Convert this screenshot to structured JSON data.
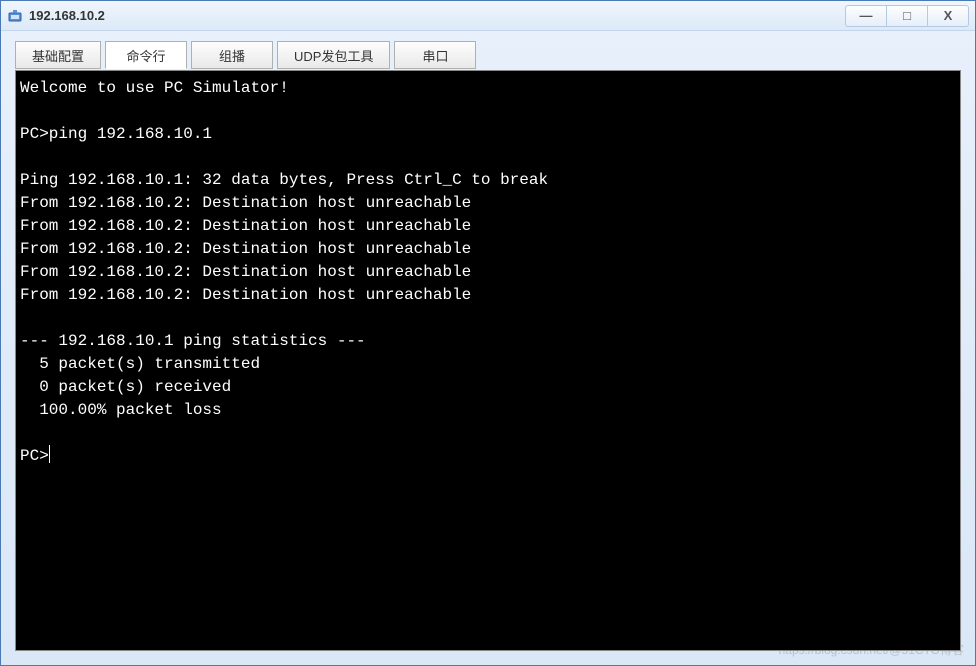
{
  "window": {
    "title": "192.168.10.2"
  },
  "controls": {
    "minimize": "—",
    "maximize": "□",
    "close": "X"
  },
  "tabs": [
    {
      "label": "基础配置",
      "active": false
    },
    {
      "label": "命令行",
      "active": true
    },
    {
      "label": "组播",
      "active": false
    },
    {
      "label": "UDP发包工具",
      "active": false
    },
    {
      "label": "串口",
      "active": false
    }
  ],
  "terminal": {
    "lines": [
      "Welcome to use PC Simulator!",
      "",
      "PC>ping 192.168.10.1",
      "",
      "Ping 192.168.10.1: 32 data bytes, Press Ctrl_C to break",
      "From 192.168.10.2: Destination host unreachable",
      "From 192.168.10.2: Destination host unreachable",
      "From 192.168.10.2: Destination host unreachable",
      "From 192.168.10.2: Destination host unreachable",
      "From 192.168.10.2: Destination host unreachable",
      "",
      "--- 192.168.10.1 ping statistics ---",
      "  5 packet(s) transmitted",
      "  0 packet(s) received",
      "  100.00% packet loss",
      ""
    ],
    "prompt": "PC>"
  },
  "watermark": "https://blog.csdn.net/@51CTO博客"
}
